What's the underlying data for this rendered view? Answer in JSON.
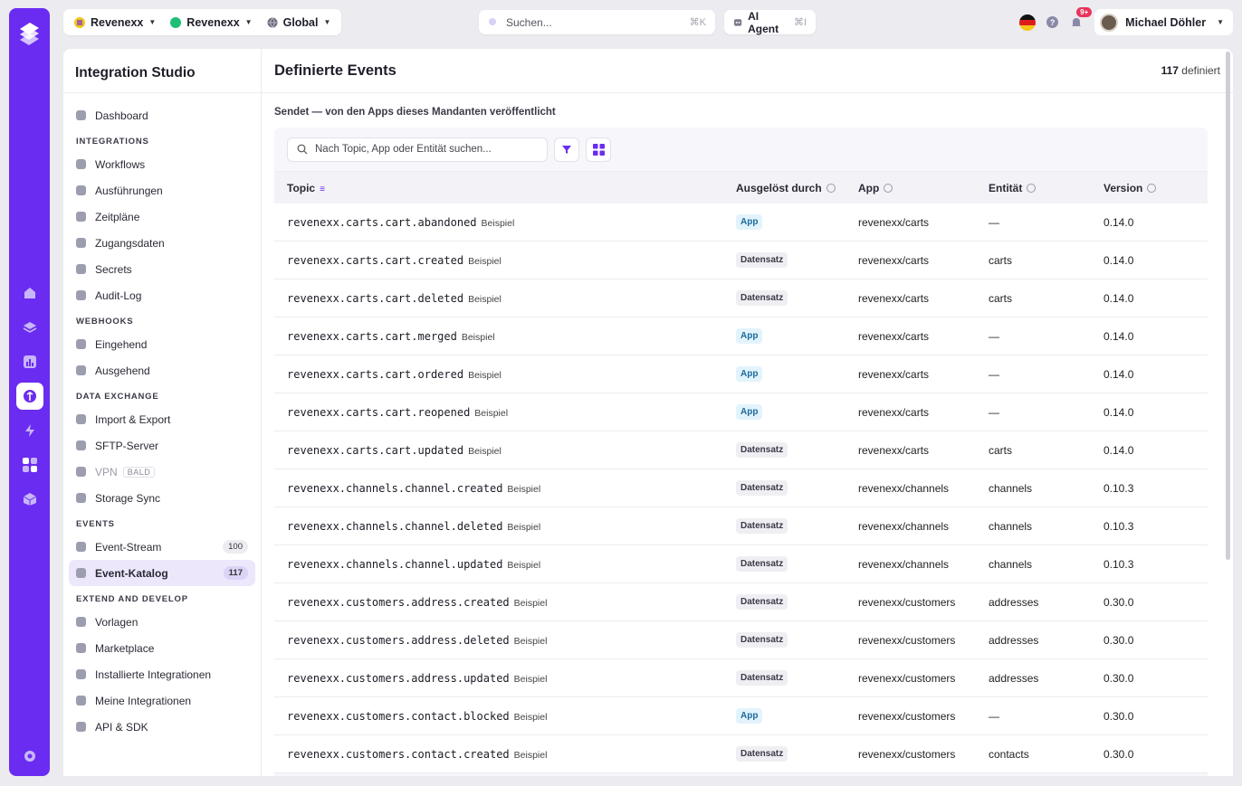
{
  "colors": {
    "accent": "#6a2cf0",
    "rail": "#6a2cf0",
    "active_nav": "#ece7fb",
    "pill_app": "#e2f3fb",
    "pill_record": "#efeff3"
  },
  "topbar": {
    "org1": "Revenexx",
    "org2": "Revenexx",
    "region": "Global",
    "search_placeholder": "Suchen...",
    "search_shortcut": "⌘K",
    "agent_label": "AI Agent",
    "agent_shortcut": "⌘I",
    "notification_badge": "9+",
    "user_name": "Michael Döhler"
  },
  "rail_icons": [
    "home-icon",
    "layers-icon",
    "chart-icon",
    "integration-icon",
    "flash-icon",
    "apps-icon",
    "cube-icon",
    "settings-icon"
  ],
  "sidebar": {
    "title": "Integration Studio",
    "dashboard": "Dashboard",
    "sections": [
      {
        "title": "Integrations",
        "items": [
          {
            "label": "Workflows",
            "icon": "workflow-icon"
          },
          {
            "label": "Ausführungen",
            "icon": "run-icon"
          },
          {
            "label": "Zeitpläne",
            "icon": "clock-icon"
          },
          {
            "label": "Zugangsdaten",
            "icon": "shield-icon"
          },
          {
            "label": "Secrets",
            "icon": "key-icon"
          },
          {
            "label": "Audit-Log",
            "icon": "audit-icon"
          }
        ]
      },
      {
        "title": "Webhooks",
        "items": [
          {
            "label": "Eingehend",
            "icon": "incoming-icon"
          },
          {
            "label": "Ausgehend",
            "icon": "outgoing-icon"
          }
        ]
      },
      {
        "title": "Data Exchange",
        "items": [
          {
            "label": "Import & Export",
            "icon": "database-icon"
          },
          {
            "label": "SFTP-Server",
            "icon": "server-icon"
          },
          {
            "label": "VPN",
            "icon": "vpn-icon",
            "tag": "BALD",
            "dim": true
          },
          {
            "label": "Storage Sync",
            "icon": "storage-icon"
          }
        ]
      },
      {
        "title": "Events",
        "items": [
          {
            "label": "Event-Stream",
            "icon": "stream-icon",
            "count": "100"
          },
          {
            "label": "Event-Katalog",
            "icon": "catalog-icon",
            "count": "117",
            "active": true
          }
        ]
      },
      {
        "title": "Extend and Develop",
        "items": [
          {
            "label": "Vorlagen",
            "icon": "template-icon"
          },
          {
            "label": "Marketplace",
            "icon": "marketplace-icon"
          },
          {
            "label": "Installierte Integrationen",
            "icon": "installed-icon"
          },
          {
            "label": "Meine Integrationen",
            "icon": "package-icon"
          },
          {
            "label": "API & SDK",
            "icon": "api-icon"
          }
        ]
      }
    ]
  },
  "main": {
    "title": "Definierte Events",
    "count": "117",
    "count_suffix": "definiert",
    "subtitle": "Sendet — von den Apps dieses Mandanten veröffentlicht",
    "search_placeholder": "Nach Topic, App oder Entität suchen...",
    "columns": [
      "Topic",
      "Ausgelöst durch",
      "App",
      "Entität",
      "Version"
    ],
    "rows": [
      {
        "topic": "revenexx.carts.cart.abandoned",
        "example": "Beispiel",
        "trigger": "App",
        "app": "revenexx/carts",
        "entity": "—",
        "version": "0.14.0"
      },
      {
        "topic": "revenexx.carts.cart.created",
        "example": "Beispiel",
        "trigger": "Datensatz",
        "app": "revenexx/carts",
        "entity": "carts",
        "version": "0.14.0"
      },
      {
        "topic": "revenexx.carts.cart.deleted",
        "example": "Beispiel",
        "trigger": "Datensatz",
        "app": "revenexx/carts",
        "entity": "carts",
        "version": "0.14.0"
      },
      {
        "topic": "revenexx.carts.cart.merged",
        "example": "Beispiel",
        "trigger": "App",
        "app": "revenexx/carts",
        "entity": "—",
        "version": "0.14.0"
      },
      {
        "topic": "revenexx.carts.cart.ordered",
        "example": "Beispiel",
        "trigger": "App",
        "app": "revenexx/carts",
        "entity": "—",
        "version": "0.14.0"
      },
      {
        "topic": "revenexx.carts.cart.reopened",
        "example": "Beispiel",
        "trigger": "App",
        "app": "revenexx/carts",
        "entity": "—",
        "version": "0.14.0"
      },
      {
        "topic": "revenexx.carts.cart.updated",
        "example": "Beispiel",
        "trigger": "Datensatz",
        "app": "revenexx/carts",
        "entity": "carts",
        "version": "0.14.0"
      },
      {
        "topic": "revenexx.channels.channel.created",
        "example": "Beispiel",
        "trigger": "Datensatz",
        "app": "revenexx/channels",
        "entity": "channels",
        "version": "0.10.3"
      },
      {
        "topic": "revenexx.channels.channel.deleted",
        "example": "Beispiel",
        "trigger": "Datensatz",
        "app": "revenexx/channels",
        "entity": "channels",
        "version": "0.10.3"
      },
      {
        "topic": "revenexx.channels.channel.updated",
        "example": "Beispiel",
        "trigger": "Datensatz",
        "app": "revenexx/channels",
        "entity": "channels",
        "version": "0.10.3"
      },
      {
        "topic": "revenexx.customers.address.created",
        "example": "Beispiel",
        "trigger": "Datensatz",
        "app": "revenexx/customers",
        "entity": "addresses",
        "version": "0.30.0"
      },
      {
        "topic": "revenexx.customers.address.deleted",
        "example": "Beispiel",
        "trigger": "Datensatz",
        "app": "revenexx/customers",
        "entity": "addresses",
        "version": "0.30.0"
      },
      {
        "topic": "revenexx.customers.address.updated",
        "example": "Beispiel",
        "trigger": "Datensatz",
        "app": "revenexx/customers",
        "entity": "addresses",
        "version": "0.30.0"
      },
      {
        "topic": "revenexx.customers.contact.blocked",
        "example": "Beispiel",
        "trigger": "App",
        "app": "revenexx/customers",
        "entity": "—",
        "version": "0.30.0"
      },
      {
        "topic": "revenexx.customers.contact.created",
        "example": "Beispiel",
        "trigger": "Datensatz",
        "app": "revenexx/customers",
        "entity": "contacts",
        "version": "0.30.0"
      }
    ]
  }
}
